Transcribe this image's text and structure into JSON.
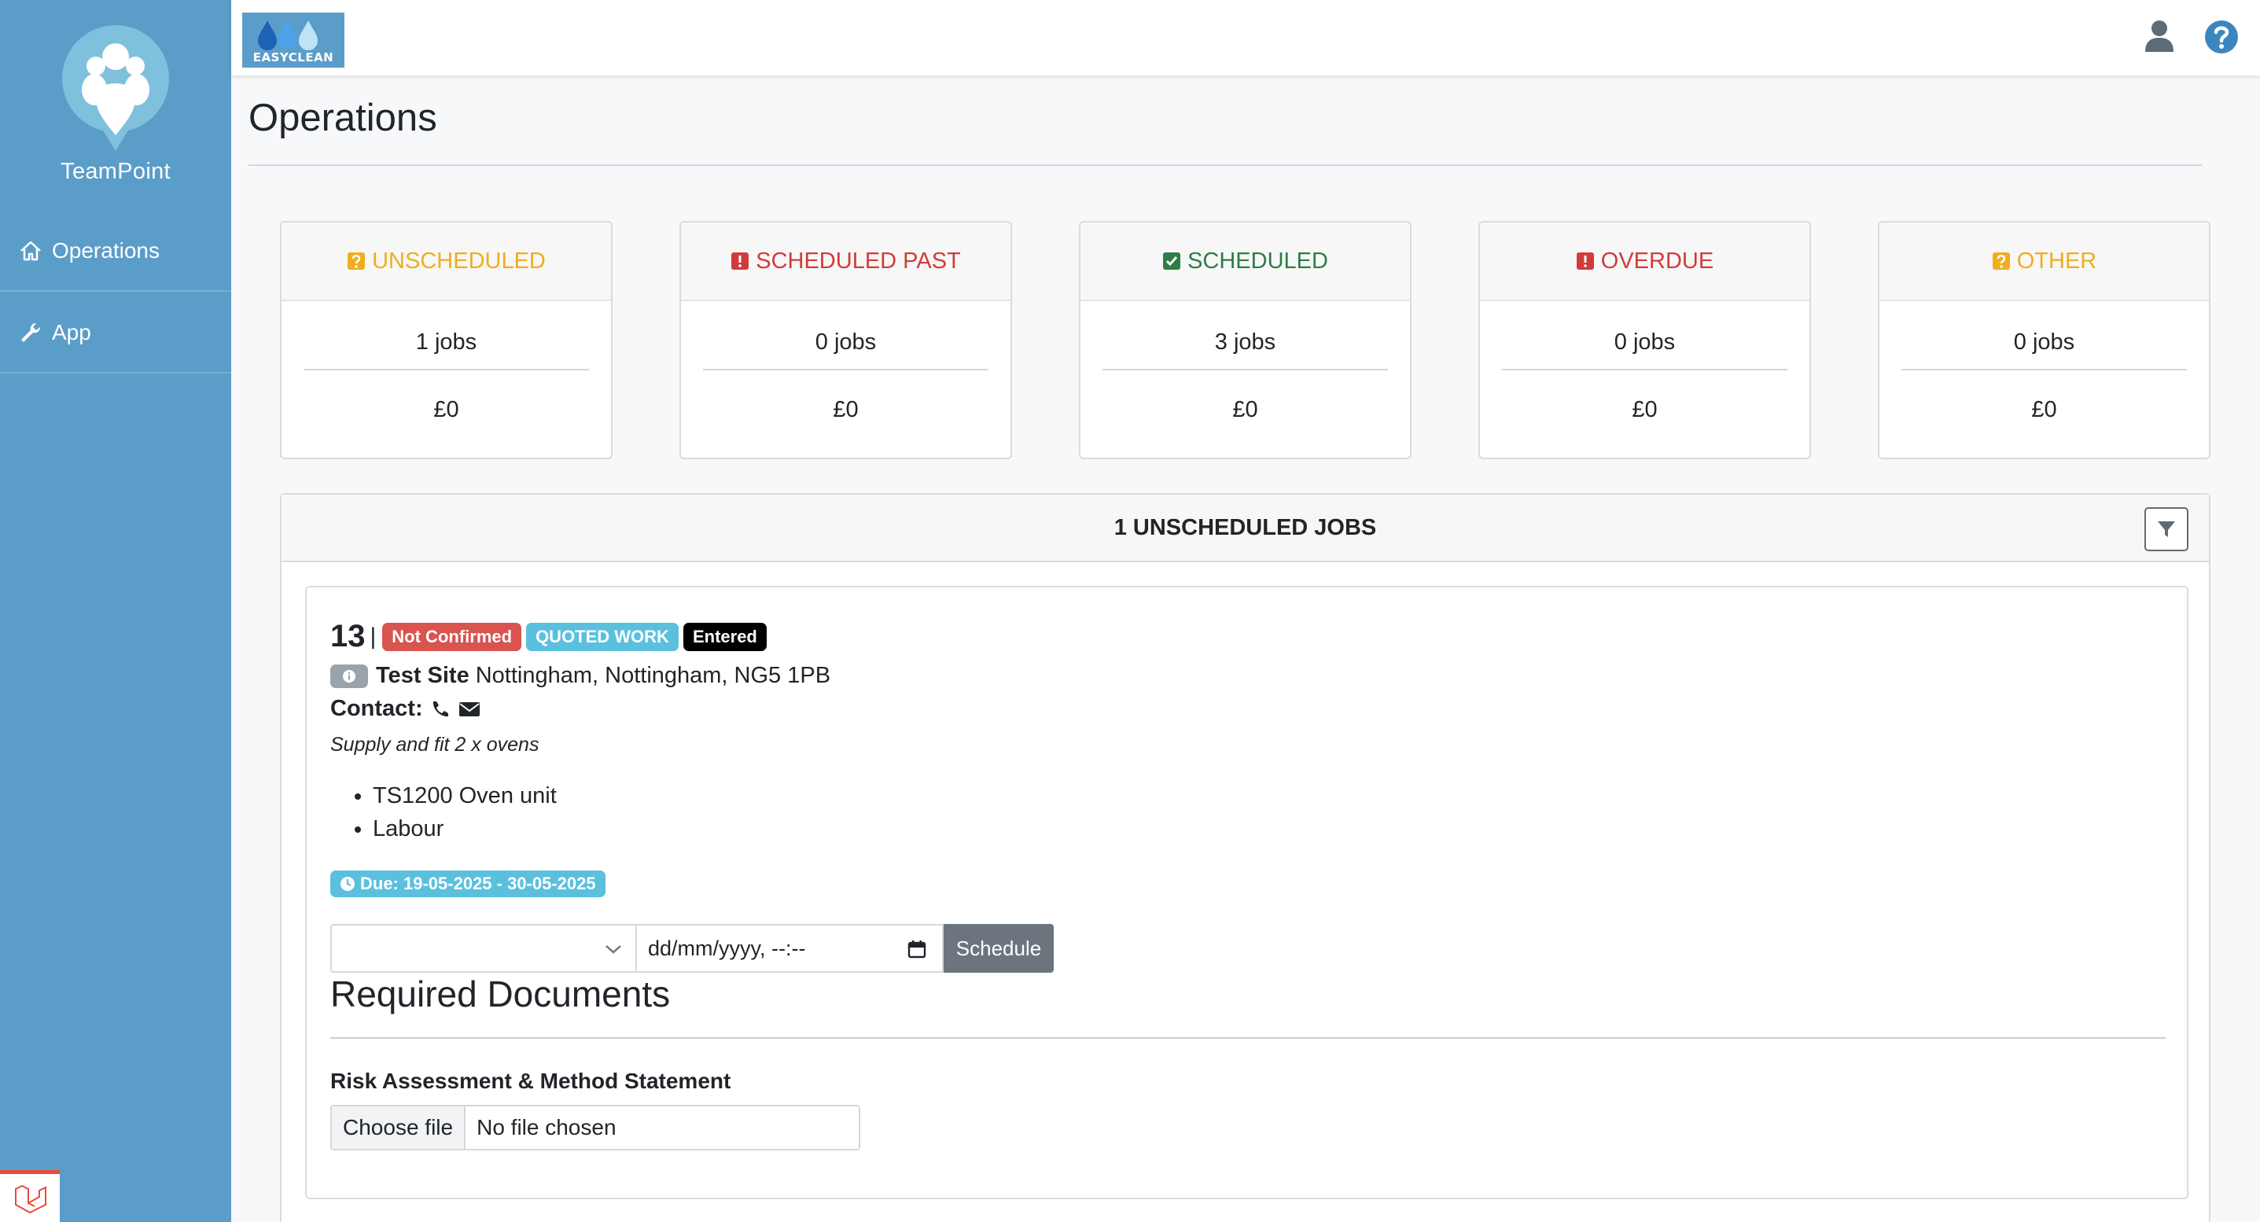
{
  "sidebar": {
    "brand_name": "TeamPoint",
    "items": [
      {
        "label": "Operations",
        "icon": "home-icon"
      },
      {
        "label": "App",
        "icon": "wrench-icon"
      }
    ]
  },
  "topbar": {
    "logo_text": "EASYCLEAN"
  },
  "page": {
    "title": "Operations"
  },
  "cards": [
    {
      "label": "UNSCHEDULED",
      "jobs": "1 jobs",
      "value": "£0",
      "color": "#f0ad1e",
      "icon": "question-icon"
    },
    {
      "label": "SCHEDULED PAST",
      "jobs": "0 jobs",
      "value": "£0",
      "color": "#d23b3b",
      "icon": "exclamation-icon"
    },
    {
      "label": "SCHEDULED",
      "jobs": "3 jobs",
      "value": "£0",
      "color": "#2e7d46",
      "icon": "check-icon"
    },
    {
      "label": "OVERDUE",
      "jobs": "0 jobs",
      "value": "£0",
      "color": "#d23b3b",
      "icon": "exclamation-icon"
    },
    {
      "label": "OTHER",
      "jobs": "0 jobs",
      "value": "£0",
      "color": "#f0ad1e",
      "icon": "question-icon"
    }
  ],
  "panel": {
    "title": "1 UNSCHEDULED JOBS"
  },
  "job": {
    "number": "13",
    "separator": "|",
    "badges": [
      "Not Confirmed",
      "QUOTED WORK",
      "Entered"
    ],
    "site_name": "Test Site",
    "address": "Nottingham, Nottingham, NG5 1PB",
    "contact_label": "Contact:",
    "description": "Supply and fit 2 x ovens",
    "items": [
      "TS1200 Oven unit",
      "Labour"
    ],
    "due": "Due: 19-05-2025 - 30-05-2025",
    "datetime_placeholder": "dd/mm/yyyy, --:--",
    "schedule_label": "Schedule",
    "required_docs_title": "Required Documents",
    "doc_label": "Risk Assessment & Method Statement",
    "file_button": "Choose file",
    "file_status": "No file chosen"
  }
}
